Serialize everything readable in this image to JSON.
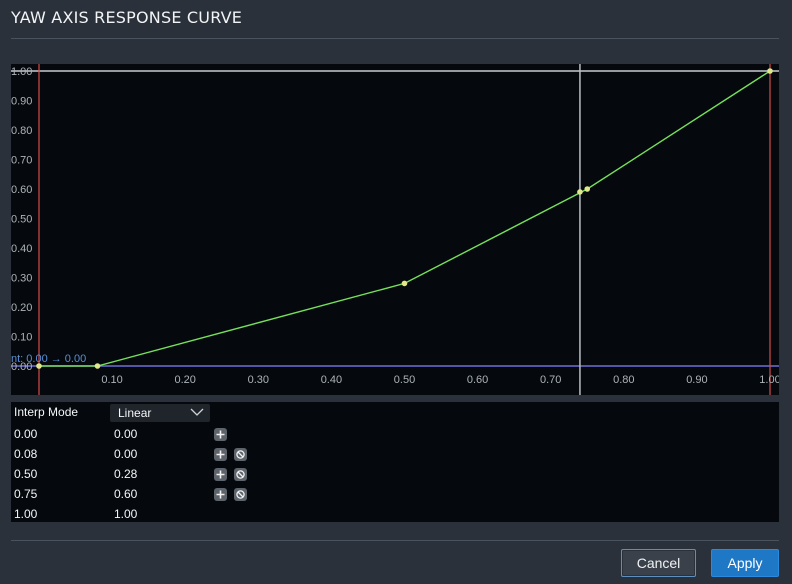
{
  "window": {
    "title": "YAW AXIS RESPONSE CURVE"
  },
  "chart_data": {
    "type": "line",
    "x_ticks": [
      "0.10",
      "0.20",
      "0.30",
      "0.40",
      "0.50",
      "0.60",
      "0.70",
      "0.80",
      "0.90",
      "1.00"
    ],
    "y_ticks": [
      "1.00",
      "0.90",
      "0.80",
      "0.70",
      "0.60",
      "0.50",
      "0.40",
      "0.30",
      "0.20",
      "0.10",
      "0.00"
    ],
    "xlim": [
      0,
      1
    ],
    "ylim": [
      0,
      1
    ],
    "points": [
      {
        "x": 0.0,
        "y": 0.0
      },
      {
        "x": 0.08,
        "y": 0.0
      },
      {
        "x": 0.5,
        "y": 0.28
      },
      {
        "x": 0.75,
        "y": 0.6
      },
      {
        "x": 1.0,
        "y": 1.0
      }
    ],
    "cursor": {
      "x": 0.74,
      "y": 0.59
    },
    "deadzone_label": "nt: 0.00 → 0.00",
    "colors": {
      "curve": "#76e05a",
      "point": "#dfe88a",
      "bounds": "#d54b4b",
      "baseline": "#6f6fd8",
      "cursor": "#b9bec4",
      "top_line": "#c8ccd0",
      "tick_label": "#aeb3b9"
    }
  },
  "table": {
    "header": {
      "label": "Interp Mode",
      "value": "Linear"
    },
    "rows": [
      {
        "in": "0.00",
        "out": "0.00",
        "add": true,
        "remove": false
      },
      {
        "in": "0.08",
        "out": "0.00",
        "add": true,
        "remove": true
      },
      {
        "in": "0.50",
        "out": "0.28",
        "add": true,
        "remove": true
      },
      {
        "in": "0.75",
        "out": "0.60",
        "add": true,
        "remove": true
      },
      {
        "in": "1.00",
        "out": "1.00",
        "add": false,
        "remove": false
      }
    ]
  },
  "buttons": {
    "cancel": "Cancel",
    "apply": "Apply"
  }
}
